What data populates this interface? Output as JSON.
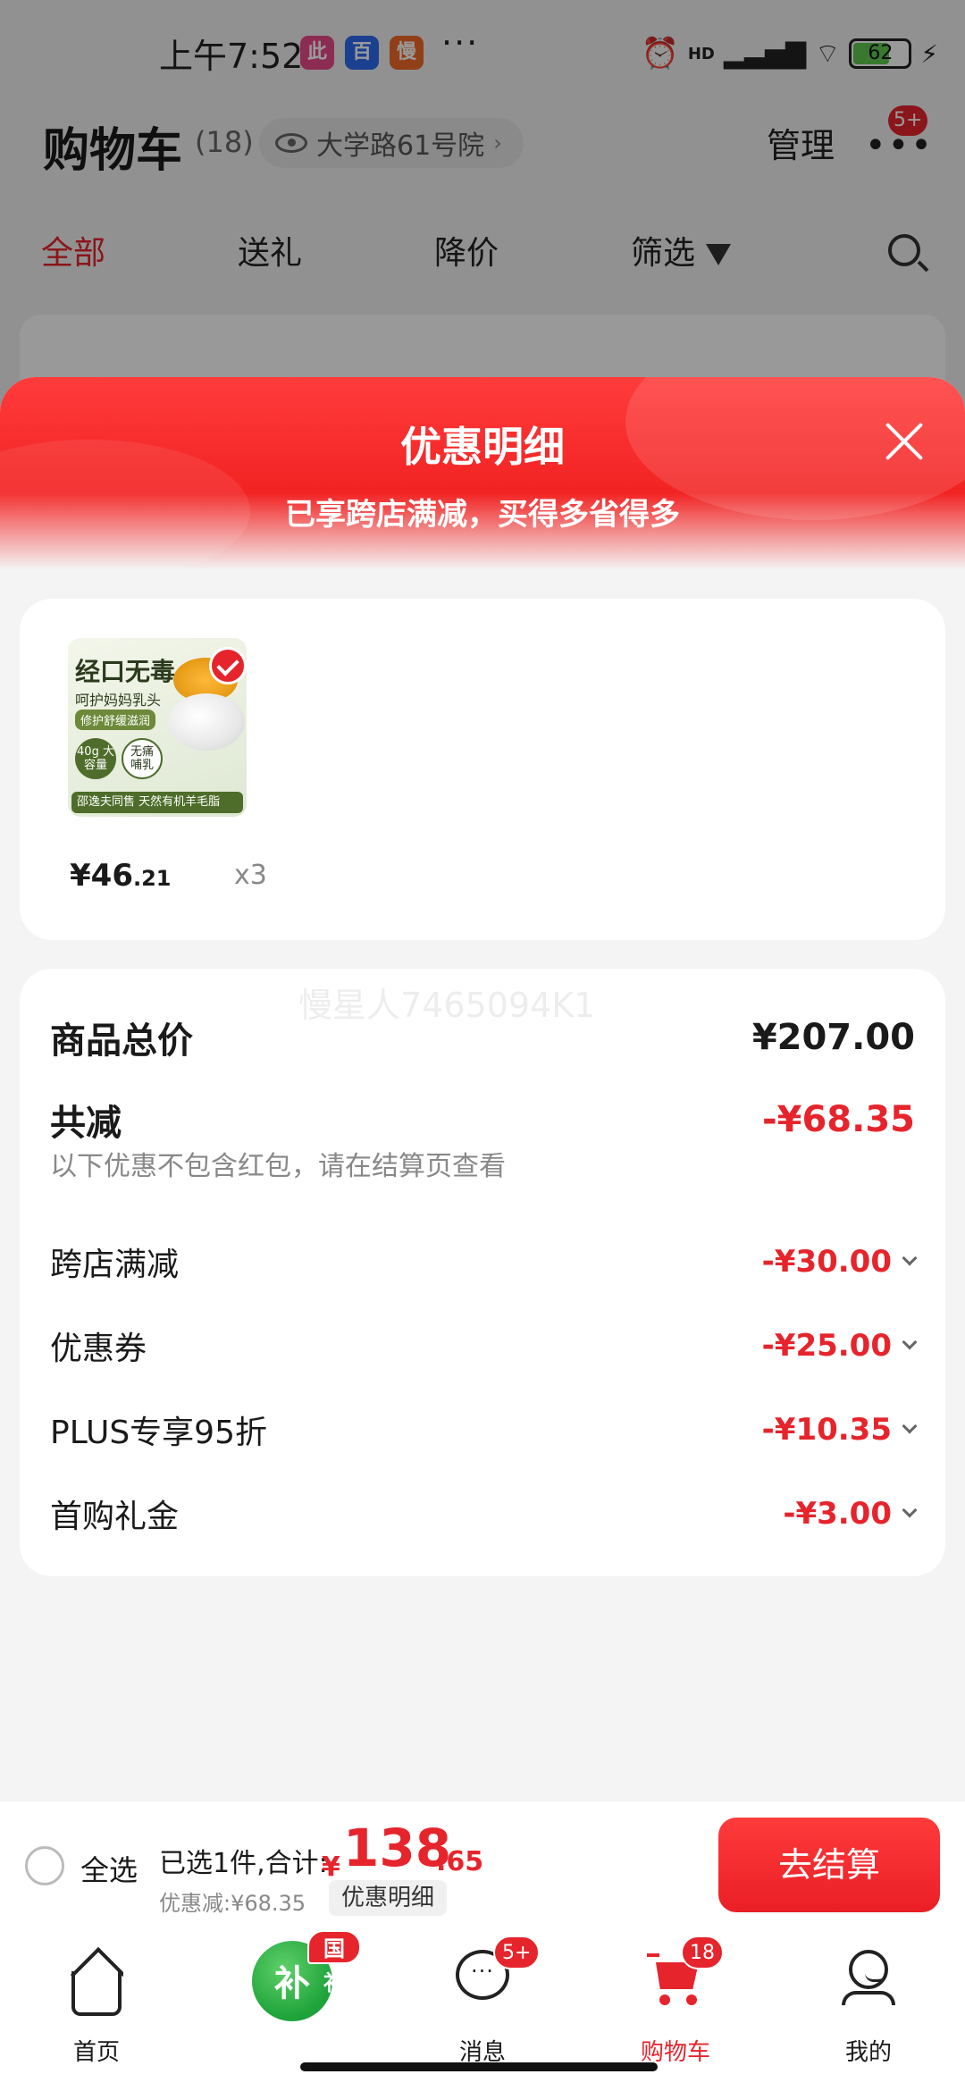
{
  "status_bar": {
    "time": "上午7:52",
    "apps": [
      "此生季",
      "百度",
      "慢"
    ],
    "more": "···",
    "network": "HD",
    "battery": "62"
  },
  "header": {
    "title": "购物车",
    "count": "(18)",
    "address": "大学路61号院",
    "manage": "管理",
    "more_badge": "5+"
  },
  "filter_tabs": [
    {
      "label": "全部",
      "active": true
    },
    {
      "label": "送礼",
      "active": false
    },
    {
      "label": "降价",
      "active": false
    },
    {
      "label": "筛选",
      "active": false
    }
  ],
  "sheet": {
    "title": "优惠明细",
    "subtitle": "已享跨店满减，买得多省得多"
  },
  "product": {
    "image_text": {
      "line1": "经口无毒",
      "line2": "呵护妈妈乳头",
      "line3": "修护舒缓滋润",
      "badge1": "40g 大容量",
      "badge2": "无痛 哺乳",
      "bottom": "邵逸夫同售 天然有机羊毛脂"
    },
    "price_main": "¥46",
    "price_cents": ".21",
    "quantity": "x3"
  },
  "watermark": "慢星人7465094K1",
  "details": {
    "total_label": "商品总价",
    "total_value": "¥207.00",
    "reduction_label": "共减",
    "reduction_value": "-¥68.35",
    "note": "以下优惠不包含红包，请在结算页查看",
    "items": [
      {
        "label": "跨店满减",
        "value": "-¥30.00"
      },
      {
        "label": "优惠券",
        "value": "-¥25.00"
      },
      {
        "label": "PLUS专享95折",
        "value": "-¥10.35"
      },
      {
        "label": "首购礼金",
        "value": "-¥3.00"
      }
    ]
  },
  "checkout": {
    "select_all": "全选",
    "summary": "已选1件,合计:",
    "yen": "¥",
    "total_main": "138",
    "total_cents": ".65",
    "discount": "优惠减:¥68.35",
    "discount_detail": "优惠明细",
    "checkout_button": "去结算"
  },
  "nav": [
    {
      "label": "首页",
      "icon": "home-icon"
    },
    {
      "label": "",
      "icon": "subsidy-icon",
      "badge": "国补",
      "icon_text": "补"
    },
    {
      "label": "消息",
      "icon": "message-icon",
      "badge": "5+"
    },
    {
      "label": "购物车",
      "icon": "cart-icon",
      "badge": "18",
      "active": true
    },
    {
      "label": "我的",
      "icon": "user-icon"
    }
  ],
  "colors": {
    "accent": "#e6242c",
    "subsidy_green": "#1ea23a"
  }
}
